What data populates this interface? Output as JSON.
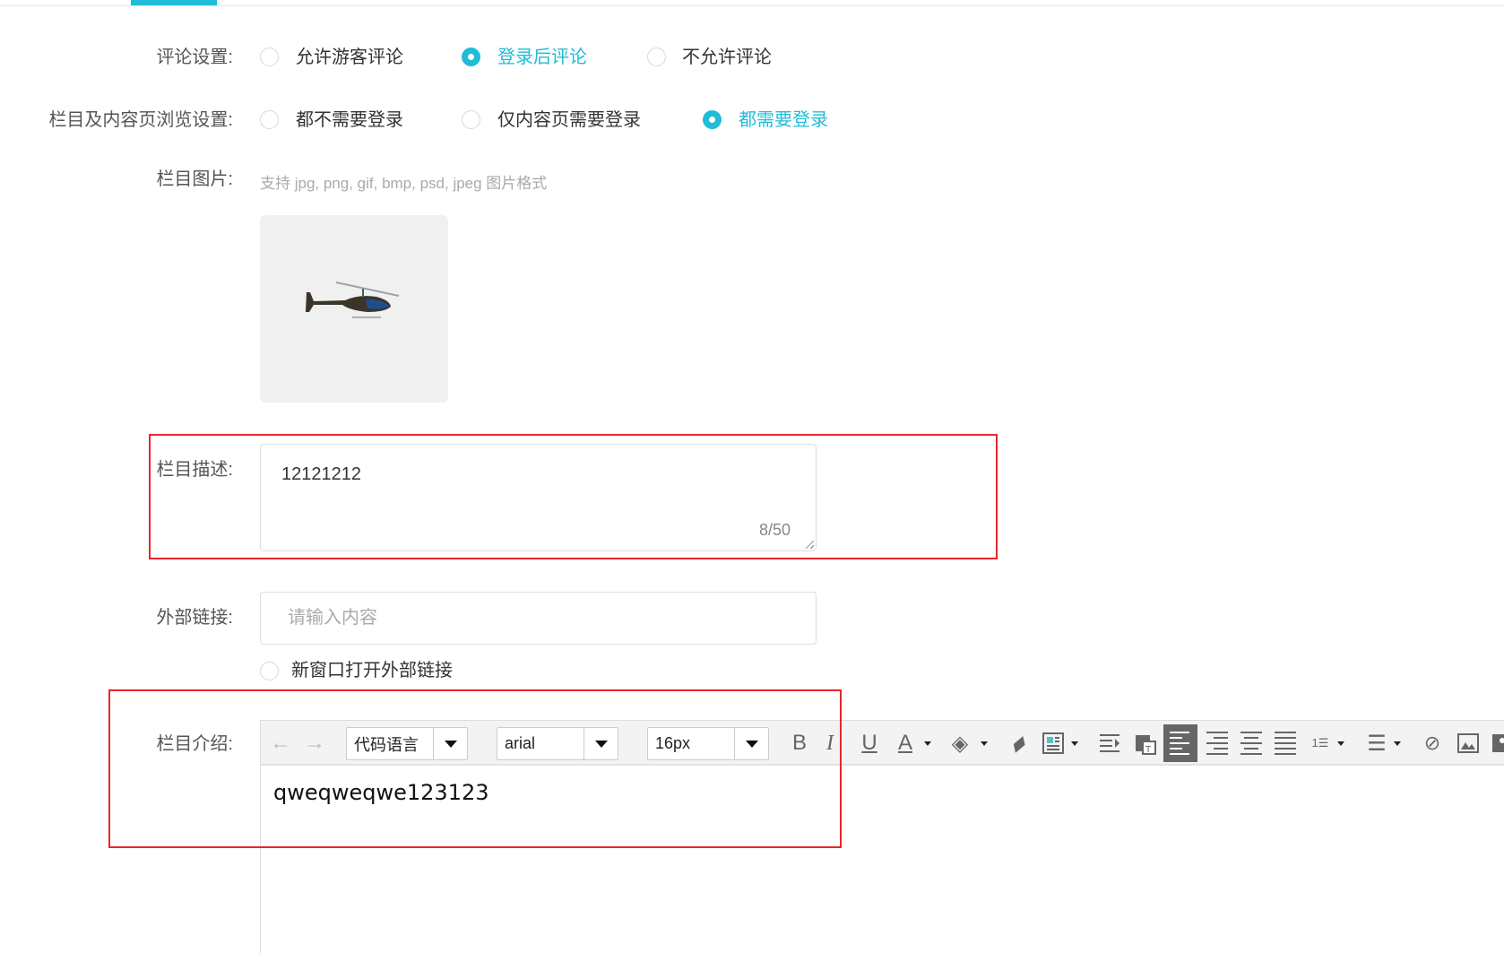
{
  "comment_setting": {
    "label": "评论设置:",
    "options": [
      {
        "label": "允许游客评论",
        "selected": false
      },
      {
        "label": "登录后评论",
        "selected": true
      },
      {
        "label": "不允许评论",
        "selected": false
      }
    ]
  },
  "browse_setting": {
    "label": "栏目及内容页浏览设置:",
    "options": [
      {
        "label": "都不需要登录",
        "selected": false
      },
      {
        "label": "仅内容页需要登录",
        "selected": false
      },
      {
        "label": "都需要登录",
        "selected": true
      }
    ]
  },
  "image": {
    "label": "栏目图片:",
    "hint": "支持 jpg, png, gif, bmp, psd, jpeg 图片格式"
  },
  "description": {
    "label": "栏目描述:",
    "value": "12121212",
    "counter": "8/50"
  },
  "external_link": {
    "label": "外部链接:",
    "placeholder": "请输入内容",
    "new_window_label": "新窗口打开外部链接"
  },
  "intro": {
    "label": "栏目介绍:",
    "content": "qweqweqwe123123",
    "toolbar": {
      "code_language": "代码语言",
      "font_family": "arial",
      "font_size": "16px"
    }
  },
  "colors": {
    "accent": "#20bcd8",
    "highlight_box": "#e8262c"
  }
}
